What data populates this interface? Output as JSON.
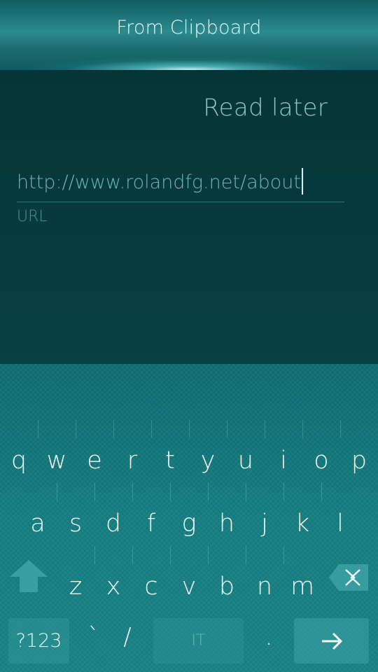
{
  "header": {
    "title": "From Clipboard"
  },
  "dialog": {
    "accept_label": "Read later"
  },
  "url_field": {
    "value": "http://www.rolandfg.net/about",
    "label": "URL"
  },
  "keyboard": {
    "row1": [
      "q",
      "w",
      "e",
      "r",
      "t",
      "y",
      "u",
      "i",
      "o",
      "p"
    ],
    "row2": [
      "a",
      "s",
      "d",
      "f",
      "g",
      "h",
      "j",
      "k",
      "l"
    ],
    "row3": [
      "z",
      "x",
      "c",
      "v",
      "b",
      "n",
      "m"
    ],
    "symbols_label": "?123",
    "backtick": "`",
    "slash": "/",
    "space_label": "IT",
    "period": ".",
    "shift_icon": "shift-arrow-icon",
    "backspace_icon": "backspace-icon",
    "enter_icon": "arrow-right-icon"
  },
  "colors": {
    "background": "#063a3e",
    "header": "#2c8a8d",
    "keyboard": "#137a7d",
    "accent_text": "#8ac7c8"
  }
}
